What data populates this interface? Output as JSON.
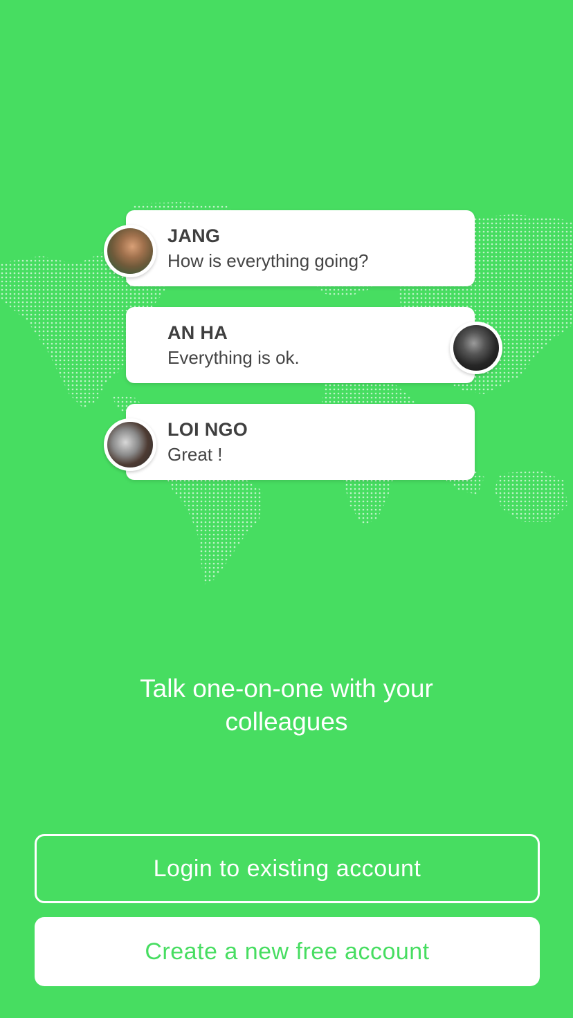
{
  "theme": {
    "background": "#47dd61",
    "bubble_background": "#ffffff",
    "name_color": "#3f3f3f",
    "message_color": "#444444"
  },
  "conversation": [
    {
      "name": "JANG",
      "message": "How is everything going?",
      "avatar": "user-photo-avatar"
    },
    {
      "name": "AN HA",
      "message": "Everything is ok.",
      "avatar": "user-photo-avatar"
    },
    {
      "name": "LOI NGO",
      "message": "Great !",
      "avatar": "user-photo-avatar"
    }
  ],
  "headline": "Talk one-on-one with your colleagues",
  "actions": {
    "login_label": "Login to existing account",
    "create_label": "Create a new free account"
  }
}
